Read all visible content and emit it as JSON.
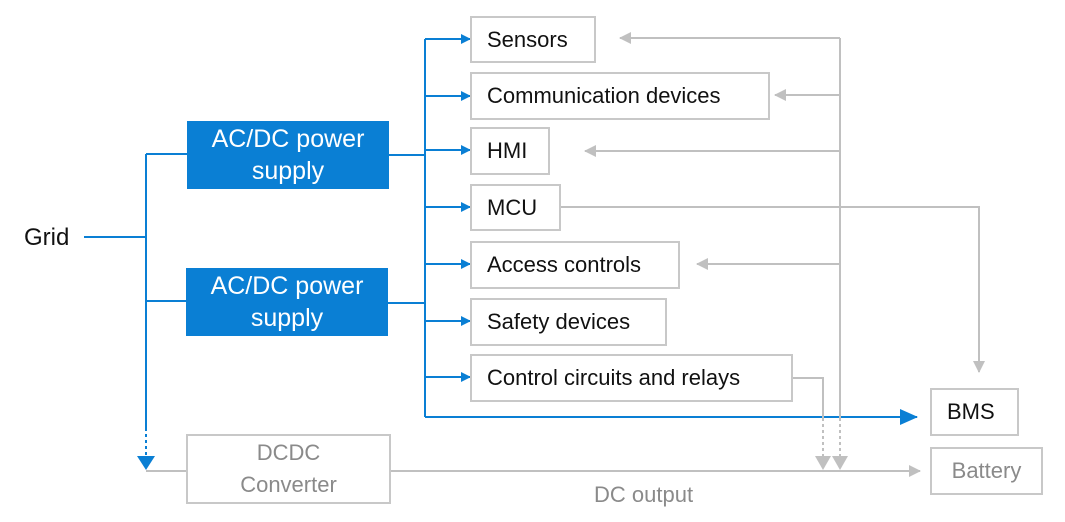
{
  "diagram": {
    "source": "Grid",
    "power_supplies": [
      {
        "line1": "AC/DC power",
        "line2": "supply"
      },
      {
        "line1": "AC/DC power",
        "line2": "supply"
      }
    ],
    "loads": [
      {
        "label": "Sensors"
      },
      {
        "label": "Communication devices"
      },
      {
        "label": "HMI"
      },
      {
        "label": "MCU"
      },
      {
        "label": "Access controls"
      },
      {
        "label": "Safety devices"
      },
      {
        "label": "Control circuits and relays"
      }
    ],
    "bms": "BMS",
    "dcdc": {
      "line1": "DCDC",
      "line2": "Converter"
    },
    "battery": "Battery",
    "dc_output": "DC output",
    "colors": {
      "primary": "#0a7fd4",
      "secondary": "#c0c0c0",
      "text": "#111111",
      "muted_text": "#8a8a8a"
    }
  }
}
